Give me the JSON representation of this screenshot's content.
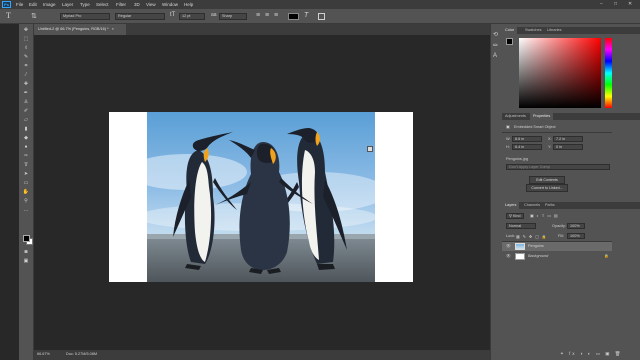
{
  "app": {
    "logo_text": "Ps"
  },
  "menu": [
    "File",
    "Edit",
    "Image",
    "Layer",
    "Type",
    "Select",
    "Filter",
    "3D",
    "View",
    "Window",
    "Help"
  ],
  "window_controls": {
    "minimize": "−",
    "maximize": "□",
    "close": "✕"
  },
  "options": {
    "font_family": "Myriad Pro",
    "font_style": "Regular",
    "font_size": "12 pt",
    "antialias": "Sharp"
  },
  "document": {
    "tab_title": "Untitled-2 @ 66.7% (Penguins, RGB/16) *",
    "zoom": "66.67%",
    "doc_info": "Doc: 5.27M/5.08M"
  },
  "color_panel": {
    "tabs": [
      "Color",
      "Swatches",
      "Libraries"
    ]
  },
  "properties_panel": {
    "tabs": [
      "Adjustments",
      "Properties"
    ],
    "object_type": "Embedded Smart Object",
    "w_label": "W:",
    "w_value": "8.6 in",
    "h_label": "H:",
    "h_value": "6.4 in",
    "x_label": "X:",
    "x_value": "7.2 in",
    "y_label": "Y:",
    "y_value": "0 in",
    "filename": "Penguins.jpg",
    "layer_comp_placeholder": "Don't Apply Layer Comp",
    "edit_contents": "Edit Contents",
    "convert_to_linked": "Convert to Linked..."
  },
  "layers_panel": {
    "tabs": [
      "Layers",
      "Channels",
      "Paths"
    ],
    "filter_kind": "Kind",
    "blend_mode": "Normal",
    "opacity_label": "Opacity:",
    "opacity_value": "100%",
    "lock_label": "Lock:",
    "fill_label": "Fill:",
    "fill_value": "100%",
    "layers": [
      {
        "name": "Penguins",
        "selected": true
      },
      {
        "name": "Background",
        "selected": false
      }
    ]
  },
  "colors": {
    "accent": "#31a8ff",
    "panel": "#535353",
    "dark": "#3c3c3c",
    "canvas": "#282828"
  }
}
